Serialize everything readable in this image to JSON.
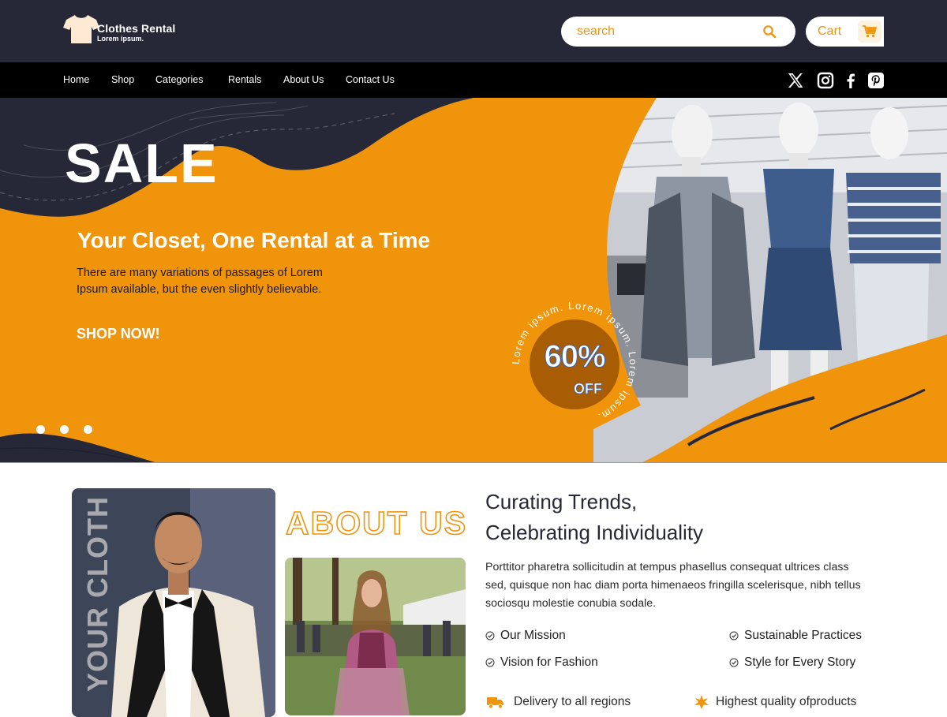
{
  "brand": {
    "name": "Clothes Rental",
    "tagline": "Lorem ipsum."
  },
  "search": {
    "placeholder": "search"
  },
  "cart": {
    "label": "Cart"
  },
  "nav": {
    "items": [
      "Home",
      "Shop",
      "Categories",
      "Rentals",
      "About Us",
      "Contact Us"
    ]
  },
  "social": [
    "x-icon",
    "instagram-icon",
    "facebook-icon",
    "pinterest-icon"
  ],
  "hero": {
    "sale": "SALE",
    "title": "Your Closet, One Rental at a Time",
    "body": "There are many variations of passages of Lorem Ipsum available, but the even slightly believable.",
    "cta": "SHOP NOW!",
    "badge_percent": "60%",
    "badge_off": "OFF",
    "badge_ring": "Lorem ipsum.  Lorem ipsum.  Lorem ipsum."
  },
  "about": {
    "vertical_text": "YOUR CLOTH",
    "title": "ABOUT US",
    "heading_line1": "Curating Trends,",
    "heading_line2": "Celebrating Individuality",
    "text": "Porttitor pharetra sollicitudin at tempus phasellus consequat ultrices class sed, quisque non hac diam porta himenaeos fringilla scelerisque, nibh tellus sociosqu molestie conubia sodale.",
    "features": [
      "Our Mission",
      "Sustainable Practices",
      "Vision for Fashion",
      "Style for Every Story"
    ],
    "perks": [
      "Delivery to all regions",
      "Highest quality ofproducts"
    ]
  },
  "colors": {
    "accent": "#f0940c",
    "dark": "#262837",
    "nav": "#000000"
  }
}
